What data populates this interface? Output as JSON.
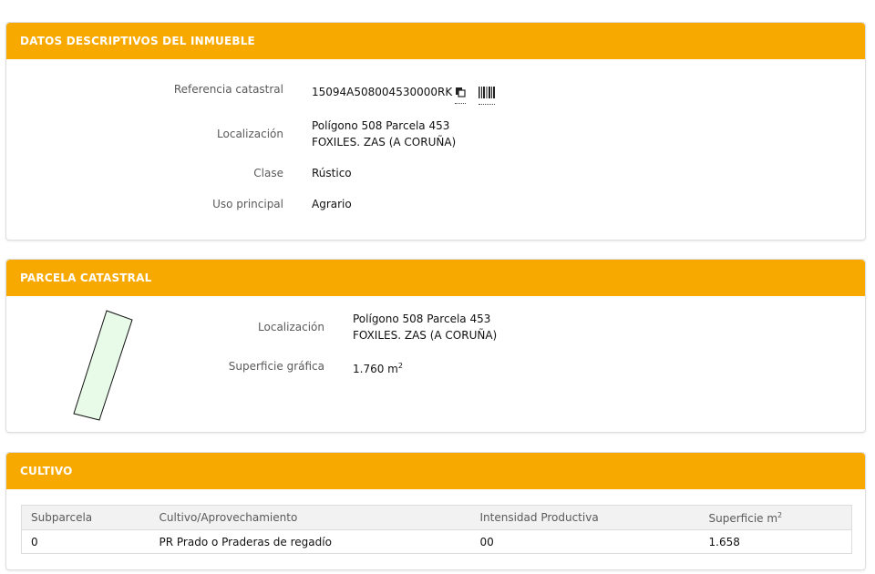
{
  "inmueble": {
    "title": "DATOS DESCRIPTIVOS DEL INMUEBLE",
    "ref_label": "Referencia catastral",
    "ref_value": "15094A508004530000RK",
    "loc_label": "Localización",
    "loc_line1": "Polígono 508 Parcela 453",
    "loc_line2": "FOXILES. ZAS (A CORUÑA)",
    "clase_label": "Clase",
    "clase_value": "Rústico",
    "uso_label": "Uso principal",
    "uso_value": "Agrario"
  },
  "parcela": {
    "title": "PARCELA CATASTRAL",
    "loc_label": "Localización",
    "loc_line1": "Polígono 508 Parcela 453",
    "loc_line2": "FOXILES. ZAS (A CORUÑA)",
    "sup_label": "Superficie gráfica",
    "sup_value": "1.760 m",
    "sup_unit_exp": "2"
  },
  "cultivo": {
    "title": "CULTIVO",
    "columns": {
      "subparcela": "Subparcela",
      "cultivo": "Cultivo/Aprovechamiento",
      "intensidad": "Intensidad Productiva",
      "superficie": "Superficie m",
      "superficie_exp": "2"
    },
    "rows": [
      {
        "subparcela": "0",
        "cultivo": "PR Prado o Praderas de regadío",
        "intensidad": "00",
        "superficie": "1.658"
      }
    ]
  },
  "colors": {
    "accent": "#f8a900",
    "parcel_fill": "#e8fbe8"
  }
}
